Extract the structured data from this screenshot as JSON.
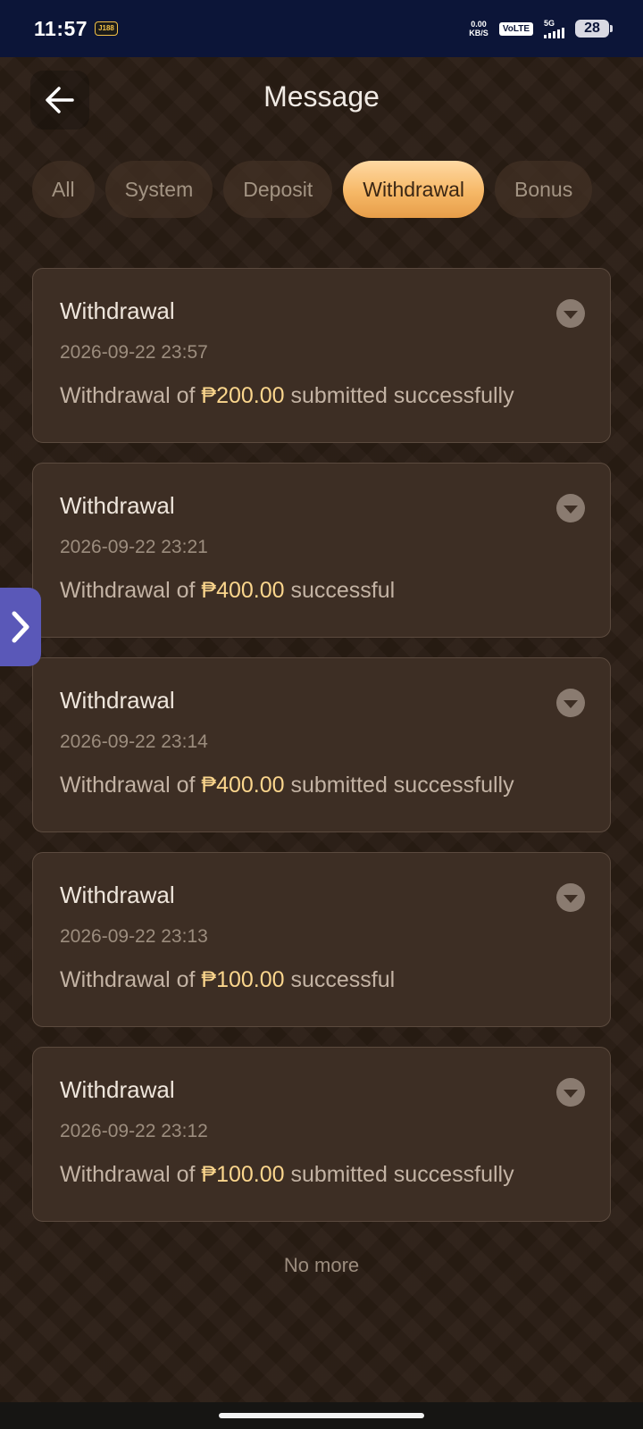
{
  "status_bar": {
    "time": "11:57",
    "app_badge": "J188",
    "net_speed_value": "0.00",
    "net_speed_unit": "KB/S",
    "volte": "VoLTE",
    "network": "5G",
    "battery": "28"
  },
  "header": {
    "title": "Message",
    "back_icon": "arrow-left-icon"
  },
  "tabs": [
    {
      "label": "All",
      "active": false
    },
    {
      "label": "System",
      "active": false
    },
    {
      "label": "Deposit",
      "active": false
    },
    {
      "label": "Withdrawal",
      "active": true
    },
    {
      "label": "Bonus",
      "active": false
    }
  ],
  "messages": [
    {
      "title": "Withdrawal",
      "time": "2026-09-22 23:57",
      "prefix": "Withdrawal of ",
      "amount": "₱200.00",
      "suffix": " submitted successfully"
    },
    {
      "title": "Withdrawal",
      "time": "2026-09-22 23:21",
      "prefix": "Withdrawal of ",
      "amount": "₱400.00",
      "suffix": " successful"
    },
    {
      "title": "Withdrawal",
      "time": "2026-09-22 23:14",
      "prefix": "Withdrawal of ",
      "amount": "₱400.00",
      "suffix": " submitted successfully"
    },
    {
      "title": "Withdrawal",
      "time": "2026-09-22 23:13",
      "prefix": "Withdrawal of ",
      "amount": "₱100.00",
      "suffix": " successful"
    },
    {
      "title": "Withdrawal",
      "time": "2026-09-22 23:12",
      "prefix": "Withdrawal of ",
      "amount": "₱100.00",
      "suffix": " submitted successfully"
    }
  ],
  "footer": {
    "no_more": "No more"
  },
  "colors": {
    "background": "#2a1d14",
    "card": "#3d2e24",
    "accent": "#f6b867",
    "amount": "#fbd68d",
    "side_handle": "#5a58b8"
  }
}
